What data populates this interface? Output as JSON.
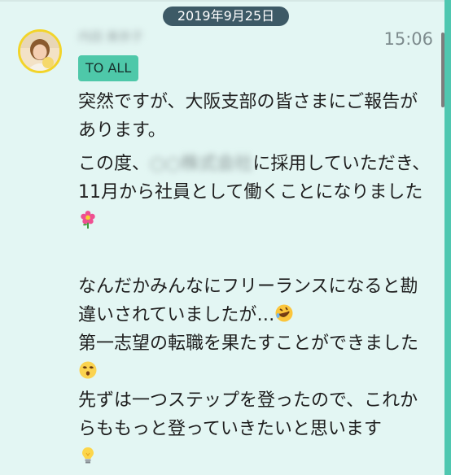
{
  "chat": {
    "date": "2019年9月25日",
    "sender_name": "内田 美奈子",
    "time": "15:06",
    "tag": "TO ALL"
  },
  "message": {
    "line1": "突然ですが、大阪支部の皆さまにご報告があります。",
    "line2a": "この度、",
    "line2_blurred": "○○株式会社",
    "line2b": "に採用していただき、11月から社員として働くことになりました",
    "line3": "なんだかみんなにフリーランスになると勘違いされていましたが…",
    "line4": "第一志望の転職を果たすことができました",
    "line5": "先ずは一つステップを登ったので、これからももっと登っていきたいと思います"
  },
  "icons": {
    "avatar": "user-avatar-icon",
    "flower": "blossom-emoji-icon",
    "rofl": "rolling-laughing-emoji-icon",
    "dizzy": "dizzy-face-emoji-icon",
    "bulb": "light-bulb-emoji-icon"
  },
  "colors": {
    "background": "#e3f6f3",
    "date_pill": "#3d5a66",
    "tag": "#4ec8a9",
    "scrollbar": "#4fc7b0",
    "avatar_ring": "#f2d42a"
  }
}
